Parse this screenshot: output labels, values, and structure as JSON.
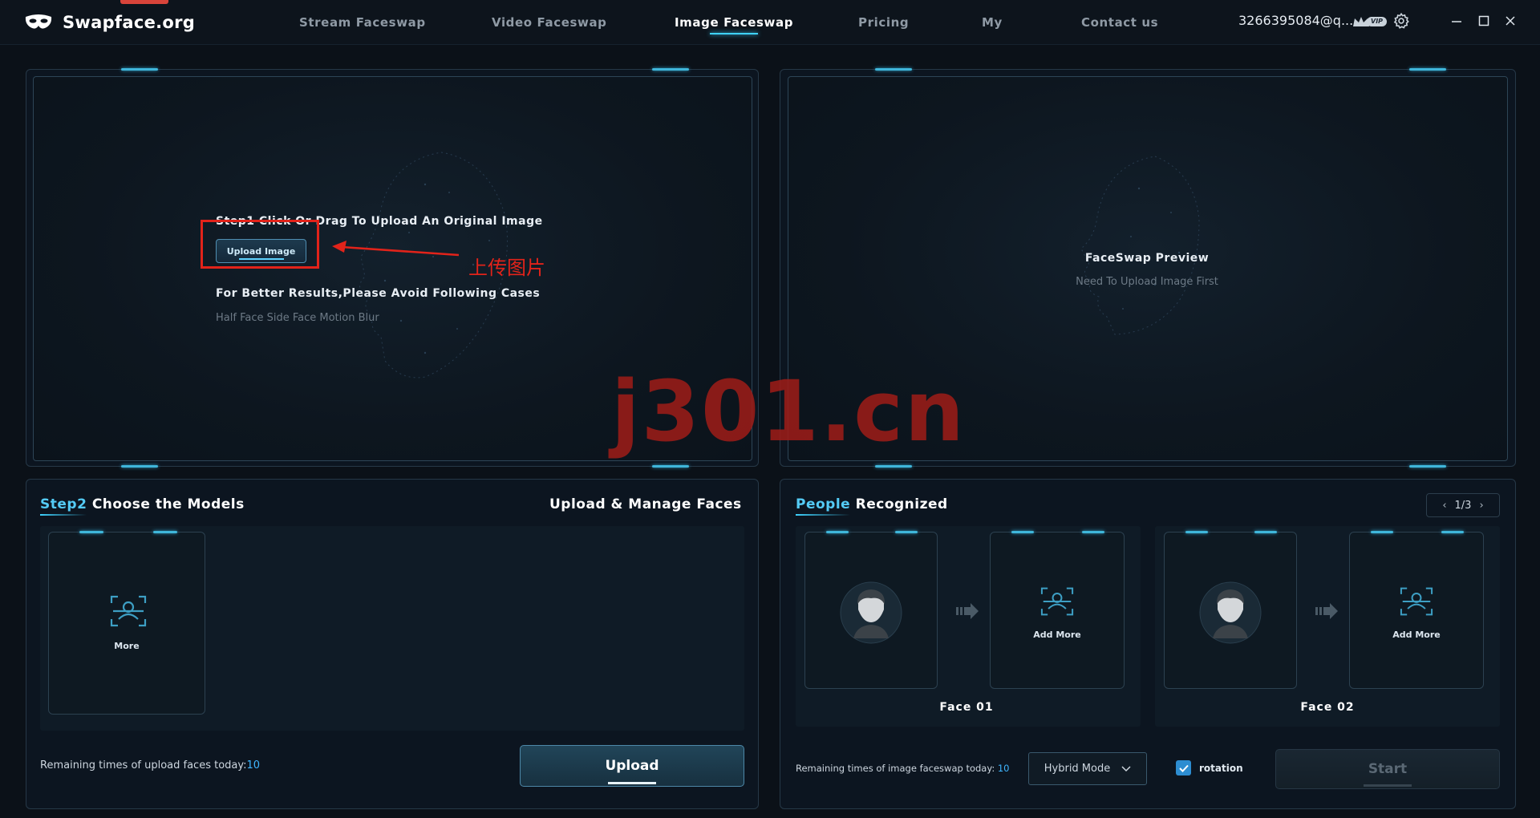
{
  "app": {
    "brand": "Swapface.org",
    "account": "3266395084@q...",
    "vip_label": "VIP"
  },
  "nav": [
    {
      "label": "Stream Faceswap",
      "active": false
    },
    {
      "label": "Video Faceswap",
      "active": false
    },
    {
      "label": "Image Faceswap",
      "active": true
    },
    {
      "label": "Pricing",
      "active": false
    },
    {
      "label": "My",
      "active": false
    },
    {
      "label": "Contact us",
      "active": false
    }
  ],
  "upload_panel": {
    "step_text": "Step1 Click Or Drag To Upload An Original Image",
    "button_label": "Upload Image",
    "annotation": "上传图片",
    "cases_title": "For Better Results,Please Avoid Following Cases",
    "cases_list": "Half Face  Side Face  Motion Blur"
  },
  "preview_panel": {
    "title": "FaceSwap Preview",
    "subtitle": "Need To Upload Image First"
  },
  "watermark": "j301.cn",
  "models": {
    "title_highlight": "Step2",
    "title_rest": " Choose the Models",
    "manage_link": "Upload & Manage Faces",
    "more_label": "More",
    "remaining_label": "Remaining times of upload faces today:",
    "remaining_count": "10",
    "upload_button": "Upload"
  },
  "people": {
    "title_highlight": "People",
    "title_rest": " Recognized",
    "pager": "1/3",
    "faces": [
      {
        "label": "Face 01",
        "add_label": "Add More"
      },
      {
        "label": "Face 02",
        "add_label": "Add More"
      }
    ],
    "remaining_label": "Remaining times of image faceswap today: ",
    "remaining_count": "10",
    "mode": "Hybrid Mode",
    "rotation_label": "rotation",
    "rotation_checked": true,
    "start_button": "Start"
  },
  "colors": {
    "accent": "#3fd3ff",
    "annotation_red": "#e2231a",
    "count_blue": "#3fb6ff"
  }
}
